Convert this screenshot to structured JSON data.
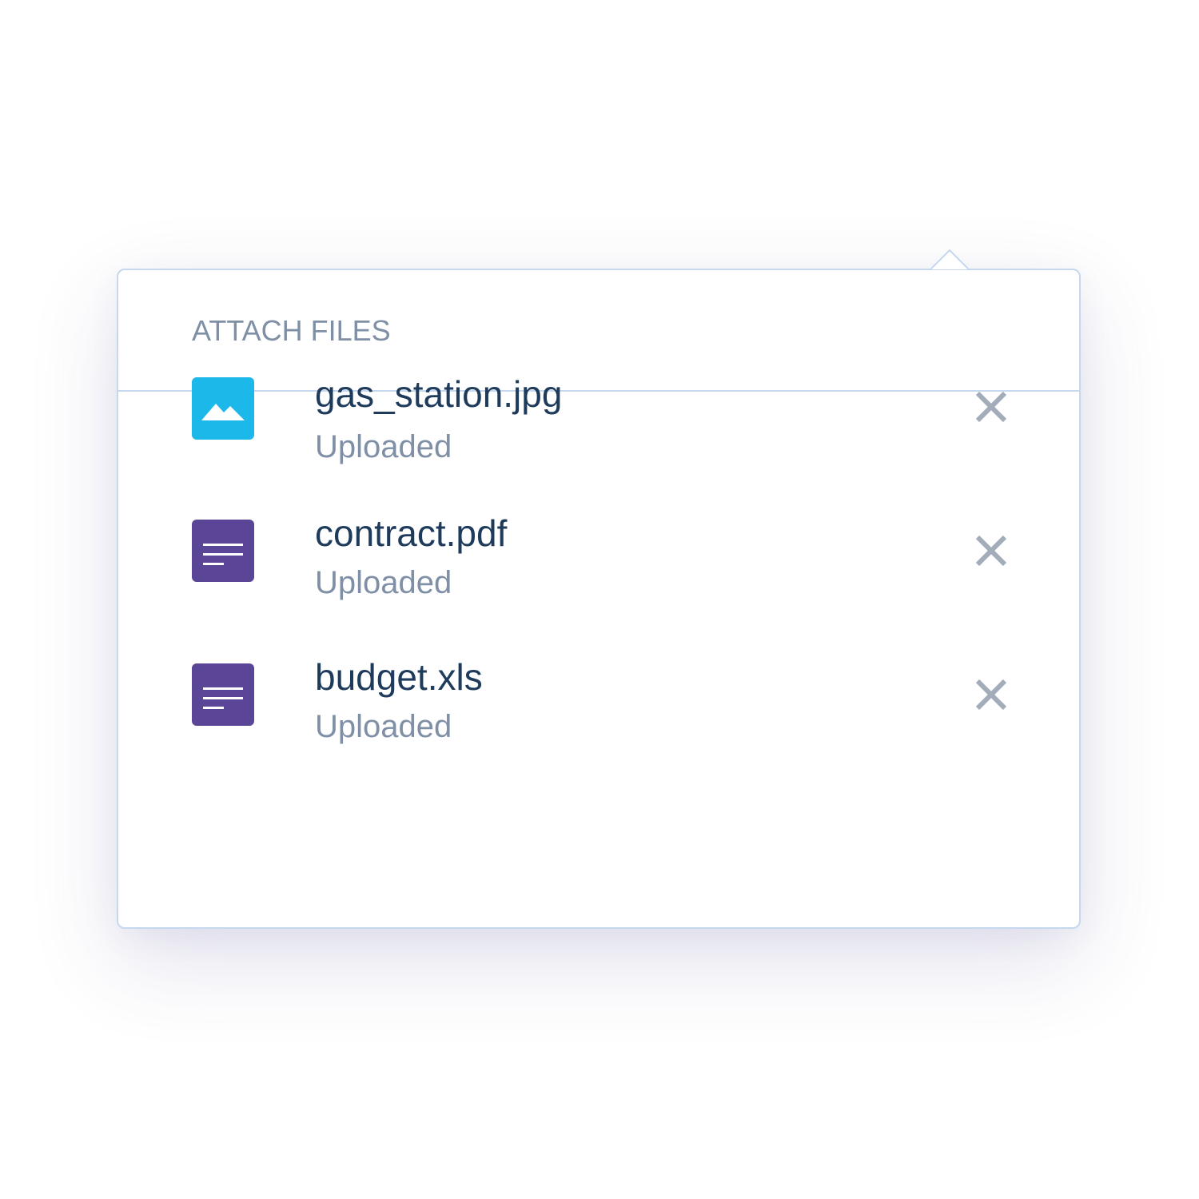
{
  "panel": {
    "title": "ATTACH FILES"
  },
  "files": [
    {
      "name": "gas_station.jpg",
      "status": "Uploaded",
      "icon": "image-icon",
      "icon_color": "#1db8ea"
    },
    {
      "name": "contract.pdf",
      "status": "Uploaded",
      "icon": "document-icon",
      "icon_color": "#5a4596"
    },
    {
      "name": "budget.xls",
      "status": "Uploaded",
      "icon": "document-icon",
      "icon_color": "#5a4596"
    }
  ],
  "colors": {
    "border": "#c5d8ee",
    "title": "#7f8fa6",
    "file_name": "#1f3b5c",
    "status": "#7f8fa6",
    "remove_icon": "#a3adba"
  }
}
